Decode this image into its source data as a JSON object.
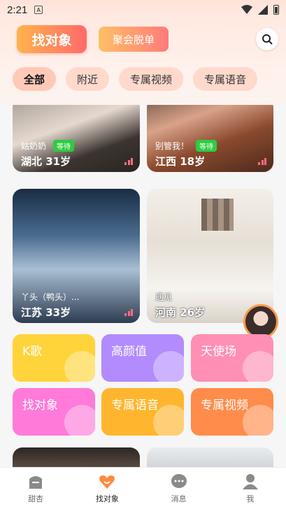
{
  "status_bar": {
    "time": "2:21",
    "notification_badge": "A"
  },
  "header": {
    "tab_main": "找对象",
    "tab_secondary": "聚会脱单",
    "search_icon": "search-icon"
  },
  "filters": [
    "全部",
    "附近",
    "专属视频",
    "专属语音"
  ],
  "cards": [
    {
      "nickname": "姑奶奶",
      "status": "等待",
      "place_age": "湖北 31岁"
    },
    {
      "nickname": "别管我！",
      "status": "等待",
      "place_age": "江西 18岁"
    },
    {
      "nickname": "丫头（鸭头）...",
      "status": "",
      "place_age": "江苏 33岁"
    },
    {
      "nickname": "遇见",
      "status": "",
      "place_age": "河南 26岁"
    }
  ],
  "categories": [
    "K歌",
    "高颜值",
    "天使场",
    "找对象",
    "专属语音",
    "专属视频"
  ],
  "bottom_nav": [
    {
      "label": "甜杏",
      "icon": "home-icon"
    },
    {
      "label": "找对象",
      "icon": "heart-icon"
    },
    {
      "label": "消息",
      "icon": "chat-icon"
    },
    {
      "label": "我",
      "icon": "user-icon"
    }
  ],
  "colors": {
    "accent": "#ff6a6a",
    "waiting": "#2ecc40",
    "nav_active": "#ff8a3d"
  }
}
